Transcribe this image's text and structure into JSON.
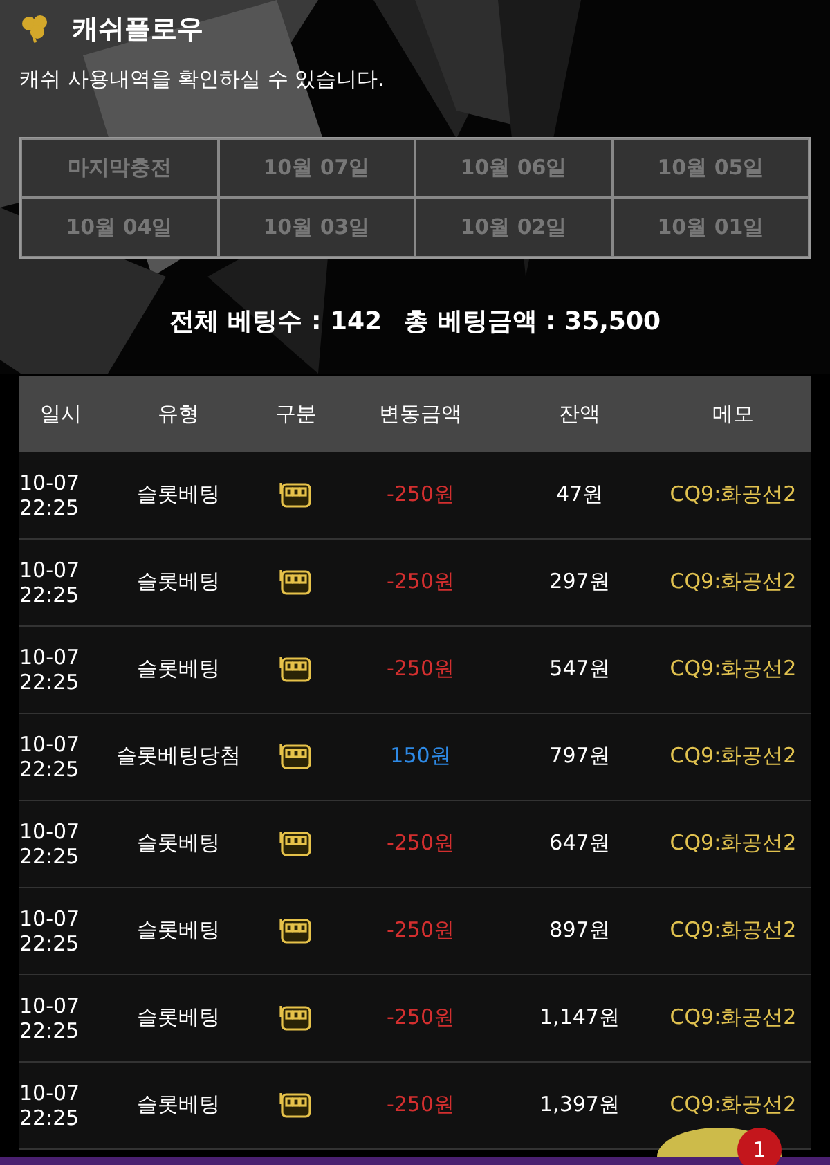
{
  "header": {
    "title": "캐쉬플로우",
    "subtitle": "캐쉬 사용내역을 확인하실 수 있습니다."
  },
  "date_filters": [
    {
      "label": "마지막충전"
    },
    {
      "label": "10월 07일"
    },
    {
      "label": "10월 06일"
    },
    {
      "label": "10월 05일"
    },
    {
      "label": "10월 04일"
    },
    {
      "label": "10월 03일"
    },
    {
      "label": "10월 02일"
    },
    {
      "label": "10월 01일"
    }
  ],
  "summary": {
    "bet_count_label": "전체 베팅수 : 142",
    "bet_amount_label": "총 베팅금액 : 35,500"
  },
  "table": {
    "columns": [
      "일시",
      "유형",
      "구분",
      "변동금액",
      "잔액",
      "메모"
    ],
    "rows": [
      {
        "date": "10-07",
        "time": "22:25",
        "type": "슬롯베팅",
        "kind": "debit",
        "amount": "-250원",
        "balance": "47원",
        "memo": "CQ9:화공선2"
      },
      {
        "date": "10-07",
        "time": "22:25",
        "type": "슬롯베팅",
        "kind": "debit",
        "amount": "-250원",
        "balance": "297원",
        "memo": "CQ9:화공선2"
      },
      {
        "date": "10-07",
        "time": "22:25",
        "type": "슬롯베팅",
        "kind": "debit",
        "amount": "-250원",
        "balance": "547원",
        "memo": "CQ9:화공선2"
      },
      {
        "date": "10-07",
        "time": "22:25",
        "type": "슬롯베팅당첨",
        "kind": "credit",
        "amount": "150원",
        "balance": "797원",
        "memo": "CQ9:화공선2"
      },
      {
        "date": "10-07",
        "time": "22:25",
        "type": "슬롯베팅",
        "kind": "debit",
        "amount": "-250원",
        "balance": "647원",
        "memo": "CQ9:화공선2"
      },
      {
        "date": "10-07",
        "time": "22:25",
        "type": "슬롯베팅",
        "kind": "debit",
        "amount": "-250원",
        "balance": "897원",
        "memo": "CQ9:화공선2"
      },
      {
        "date": "10-07",
        "time": "22:25",
        "type": "슬롯베팅",
        "kind": "debit",
        "amount": "-250원",
        "balance": "1,147원",
        "memo": "CQ9:화공선2"
      },
      {
        "date": "10-07",
        "time": "22:25",
        "type": "슬롯베팅",
        "kind": "debit",
        "amount": "-250원",
        "balance": "1,397원",
        "memo": "CQ9:화공선2"
      }
    ]
  },
  "chat_button": {
    "badge": "1"
  }
}
